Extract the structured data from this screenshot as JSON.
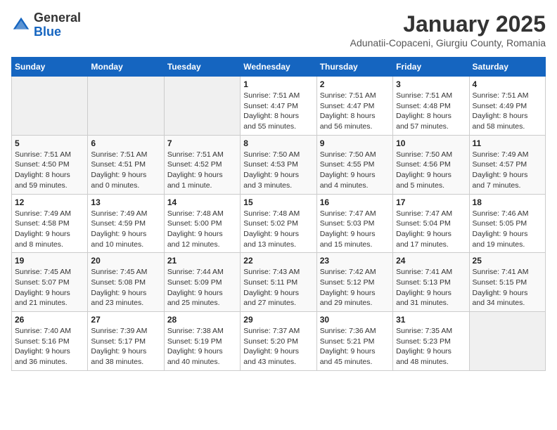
{
  "logo": {
    "general": "General",
    "blue": "Blue"
  },
  "calendar": {
    "title": "January 2025",
    "subtitle": "Adunatii-Copaceni, Giurgiu County, Romania",
    "headers": [
      "Sunday",
      "Monday",
      "Tuesday",
      "Wednesday",
      "Thursday",
      "Friday",
      "Saturday"
    ],
    "weeks": [
      [
        {
          "day": "",
          "info": ""
        },
        {
          "day": "",
          "info": ""
        },
        {
          "day": "",
          "info": ""
        },
        {
          "day": "1",
          "info": "Sunrise: 7:51 AM\nSunset: 4:47 PM\nDaylight: 8 hours\nand 55 minutes."
        },
        {
          "day": "2",
          "info": "Sunrise: 7:51 AM\nSunset: 4:47 PM\nDaylight: 8 hours\nand 56 minutes."
        },
        {
          "day": "3",
          "info": "Sunrise: 7:51 AM\nSunset: 4:48 PM\nDaylight: 8 hours\nand 57 minutes."
        },
        {
          "day": "4",
          "info": "Sunrise: 7:51 AM\nSunset: 4:49 PM\nDaylight: 8 hours\nand 58 minutes."
        }
      ],
      [
        {
          "day": "5",
          "info": "Sunrise: 7:51 AM\nSunset: 4:50 PM\nDaylight: 8 hours\nand 59 minutes."
        },
        {
          "day": "6",
          "info": "Sunrise: 7:51 AM\nSunset: 4:51 PM\nDaylight: 9 hours\nand 0 minutes."
        },
        {
          "day": "7",
          "info": "Sunrise: 7:51 AM\nSunset: 4:52 PM\nDaylight: 9 hours\nand 1 minute."
        },
        {
          "day": "8",
          "info": "Sunrise: 7:50 AM\nSunset: 4:53 PM\nDaylight: 9 hours\nand 3 minutes."
        },
        {
          "day": "9",
          "info": "Sunrise: 7:50 AM\nSunset: 4:55 PM\nDaylight: 9 hours\nand 4 minutes."
        },
        {
          "day": "10",
          "info": "Sunrise: 7:50 AM\nSunset: 4:56 PM\nDaylight: 9 hours\nand 5 minutes."
        },
        {
          "day": "11",
          "info": "Sunrise: 7:49 AM\nSunset: 4:57 PM\nDaylight: 9 hours\nand 7 minutes."
        }
      ],
      [
        {
          "day": "12",
          "info": "Sunrise: 7:49 AM\nSunset: 4:58 PM\nDaylight: 9 hours\nand 8 minutes."
        },
        {
          "day": "13",
          "info": "Sunrise: 7:49 AM\nSunset: 4:59 PM\nDaylight: 9 hours\nand 10 minutes."
        },
        {
          "day": "14",
          "info": "Sunrise: 7:48 AM\nSunset: 5:00 PM\nDaylight: 9 hours\nand 12 minutes."
        },
        {
          "day": "15",
          "info": "Sunrise: 7:48 AM\nSunset: 5:02 PM\nDaylight: 9 hours\nand 13 minutes."
        },
        {
          "day": "16",
          "info": "Sunrise: 7:47 AM\nSunset: 5:03 PM\nDaylight: 9 hours\nand 15 minutes."
        },
        {
          "day": "17",
          "info": "Sunrise: 7:47 AM\nSunset: 5:04 PM\nDaylight: 9 hours\nand 17 minutes."
        },
        {
          "day": "18",
          "info": "Sunrise: 7:46 AM\nSunset: 5:05 PM\nDaylight: 9 hours\nand 19 minutes."
        }
      ],
      [
        {
          "day": "19",
          "info": "Sunrise: 7:45 AM\nSunset: 5:07 PM\nDaylight: 9 hours\nand 21 minutes."
        },
        {
          "day": "20",
          "info": "Sunrise: 7:45 AM\nSunset: 5:08 PM\nDaylight: 9 hours\nand 23 minutes."
        },
        {
          "day": "21",
          "info": "Sunrise: 7:44 AM\nSunset: 5:09 PM\nDaylight: 9 hours\nand 25 minutes."
        },
        {
          "day": "22",
          "info": "Sunrise: 7:43 AM\nSunset: 5:11 PM\nDaylight: 9 hours\nand 27 minutes."
        },
        {
          "day": "23",
          "info": "Sunrise: 7:42 AM\nSunset: 5:12 PM\nDaylight: 9 hours\nand 29 minutes."
        },
        {
          "day": "24",
          "info": "Sunrise: 7:41 AM\nSunset: 5:13 PM\nDaylight: 9 hours\nand 31 minutes."
        },
        {
          "day": "25",
          "info": "Sunrise: 7:41 AM\nSunset: 5:15 PM\nDaylight: 9 hours\nand 34 minutes."
        }
      ],
      [
        {
          "day": "26",
          "info": "Sunrise: 7:40 AM\nSunset: 5:16 PM\nDaylight: 9 hours\nand 36 minutes."
        },
        {
          "day": "27",
          "info": "Sunrise: 7:39 AM\nSunset: 5:17 PM\nDaylight: 9 hours\nand 38 minutes."
        },
        {
          "day": "28",
          "info": "Sunrise: 7:38 AM\nSunset: 5:19 PM\nDaylight: 9 hours\nand 40 minutes."
        },
        {
          "day": "29",
          "info": "Sunrise: 7:37 AM\nSunset: 5:20 PM\nDaylight: 9 hours\nand 43 minutes."
        },
        {
          "day": "30",
          "info": "Sunrise: 7:36 AM\nSunset: 5:21 PM\nDaylight: 9 hours\nand 45 minutes."
        },
        {
          "day": "31",
          "info": "Sunrise: 7:35 AM\nSunset: 5:23 PM\nDaylight: 9 hours\nand 48 minutes."
        },
        {
          "day": "",
          "info": ""
        }
      ]
    ]
  }
}
